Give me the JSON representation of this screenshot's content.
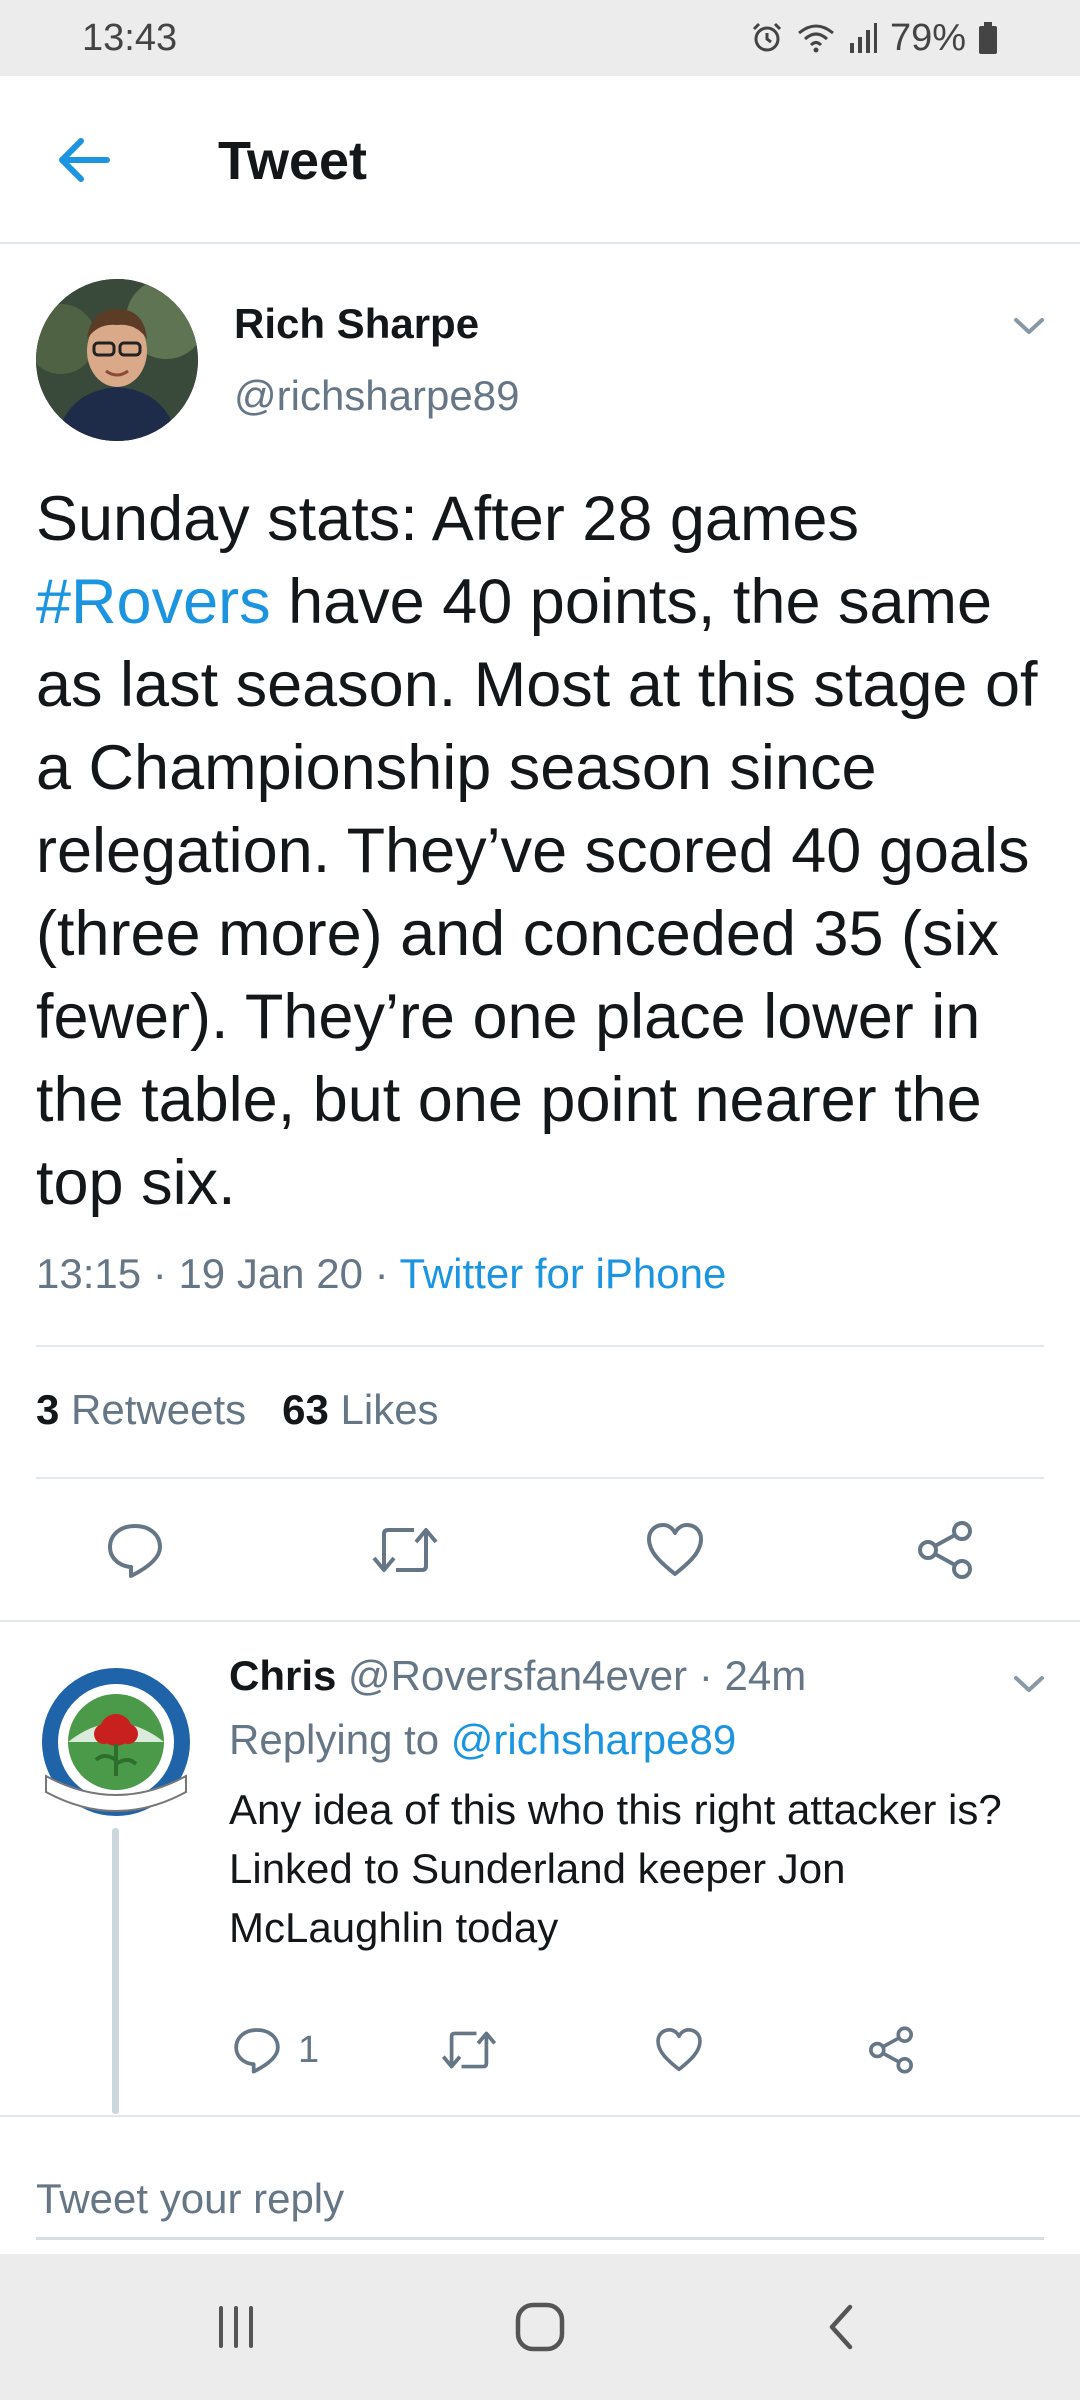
{
  "status_bar": {
    "time": "13:43",
    "battery": "79%",
    "icons": [
      "alarm-icon",
      "wifi-icon",
      "signal-icon",
      "battery-icon"
    ]
  },
  "header": {
    "title": "Tweet",
    "back_icon": "arrow-left-icon"
  },
  "tweet": {
    "author_name": "Rich Sharpe",
    "author_handle": "@richsharpe89",
    "text_before": "Sunday stats: After 28 games ",
    "hashtag": "#Rovers",
    "text_after": " have 40 points, the same as last season. Most at this stage of a Championship season since relegation. They’ve scored 40 goals (three more) and conceded 35 (six fewer). They’re one place lower in the table, but one point nearer the top six.",
    "time": "13:15",
    "date": "19 Jan 20",
    "source": "Twitter for iPhone",
    "separator": " · ",
    "retweets_count": "3",
    "retweets_label": "Retweets",
    "likes_count": "63",
    "likes_label": "Likes"
  },
  "reply": {
    "name": "Chris",
    "handle": "@Roversfan4ever",
    "age": "24m",
    "separator": " · ",
    "replying_prefix": "Replying to ",
    "replying_to": "@richsharpe89",
    "text": "Any idea of this who this right attacker is? Linked to Sunderland keeper Jon McLaughlin today",
    "reply_count": "1"
  },
  "compose": {
    "placeholder": "Tweet your reply"
  },
  "colors": {
    "accent": "#1b95e0",
    "secondary_text": "#657786",
    "primary_text": "#14171a",
    "divider": "#e1e8ed"
  }
}
